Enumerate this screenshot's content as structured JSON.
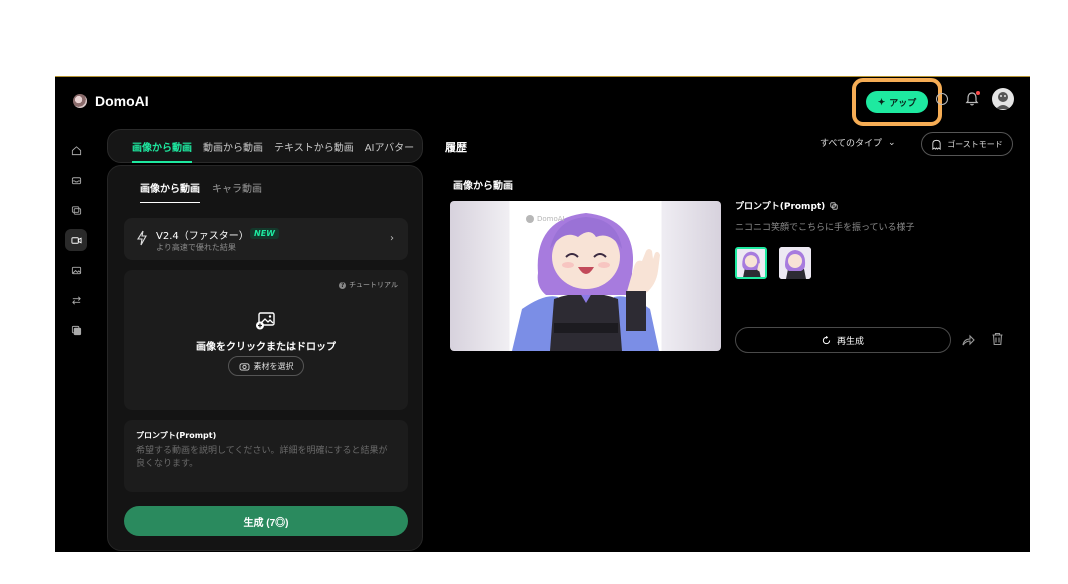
{
  "header": {
    "brand": "DomoAI",
    "app_button": "アップ"
  },
  "sidebar": {
    "items": [
      "home-icon",
      "inbox-icon",
      "copy-icon",
      "video-icon",
      "image-icon",
      "swap-icon",
      "layers-icon"
    ],
    "active_index": 3
  },
  "left_panel": {
    "tabs": [
      "画像から動画",
      "動画から動画",
      "テキストから動画",
      "AIアバター"
    ],
    "active_tab": 0,
    "subtabs": [
      "画像から動画",
      "キャラ動画"
    ],
    "active_subtab": 0,
    "model": {
      "name": "V2.4（ファスター）",
      "badge": "NEW",
      "subtitle": "より高速で優れた結果"
    },
    "upload": {
      "tutorial": "チュートリアル",
      "prompt_text": "画像をクリックまたはドロップ",
      "select_button": "素材を選択"
    },
    "prompt": {
      "label": "プロンプト(Prompt)",
      "placeholder": "希望する動画を説明してください。詳細を明確にすると結果が良くなります。"
    },
    "generate_button": "生成 (7◎)"
  },
  "history": {
    "title": "履歴",
    "type_filter": "すべてのタイプ",
    "ghost_mode": "ゴーストモード",
    "section_title": "画像から動画",
    "item": {
      "prompt_label": "プロンプト(Prompt)",
      "prompt_text": "ニコニコ笑顔でこちらに手を振っている様子",
      "watermark": "DomoAI",
      "regenerate": "再生成"
    }
  },
  "colors": {
    "accent": "#1ee9a0",
    "highlight_ring": "#f6ad55",
    "generate": "#2a8a5e"
  }
}
